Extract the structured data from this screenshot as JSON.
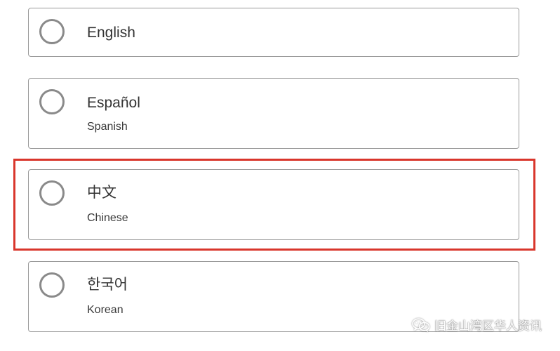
{
  "language_options": [
    {
      "label": "English",
      "sublabel": ""
    },
    {
      "label": "Español",
      "sublabel": "Spanish"
    },
    {
      "label": "中文",
      "sublabel": "Chinese"
    },
    {
      "label": "한국어",
      "sublabel": "Korean"
    }
  ],
  "highlight": {
    "color": "#d9362c",
    "target": "中文"
  },
  "watermark": {
    "icon": "wechat-icon",
    "text": "旧金山湾区华人资讯"
  }
}
